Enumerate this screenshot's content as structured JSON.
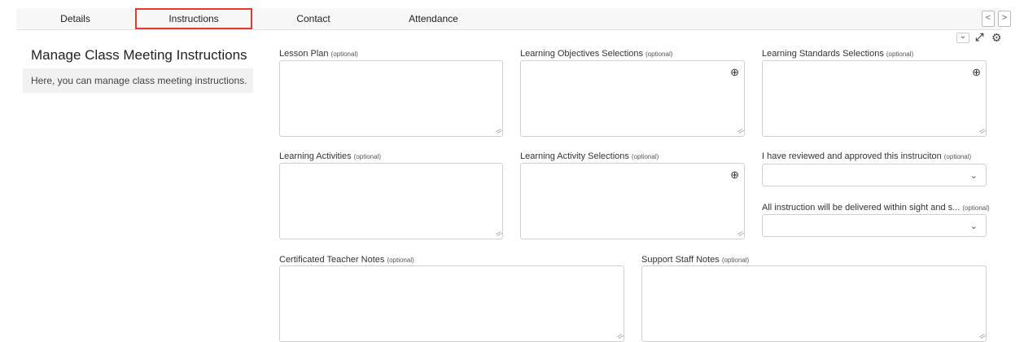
{
  "tabs": {
    "details": "Details",
    "instructions": "Instructions",
    "contact": "Contact",
    "attendance": "Attendance"
  },
  "nav": {
    "prev": "<",
    "next": ">"
  },
  "tools": {
    "dropdown": "⌄",
    "expand": "⤢",
    "settings": "⚙"
  },
  "sidebar": {
    "title": "Manage Class Meeting Instructions",
    "description": "Here, you can manage class meeting instructions."
  },
  "optional": "(optional)",
  "icons": {
    "zoom": "zoom-in-icon",
    "chevron": "chevron-down-icon",
    "resize": "resize-grip-icon"
  },
  "fields": {
    "lesson_plan": "Lesson Plan",
    "objectives": "Learning Objectives Selections",
    "standards": "Learning Standards Selections",
    "activities": "Learning Activities",
    "activity_selections": "Learning Activity Selections",
    "reviewed": "I have reviewed and approved this instruciton",
    "delivered": "All instruction will be delivered within sight and s...",
    "teacher_notes": "Certificated Teacher Notes",
    "staff_notes": "Support Staff Notes"
  },
  "glyphs": {
    "zoom": "⊕",
    "chevron": "⌄",
    "grip": "//"
  }
}
